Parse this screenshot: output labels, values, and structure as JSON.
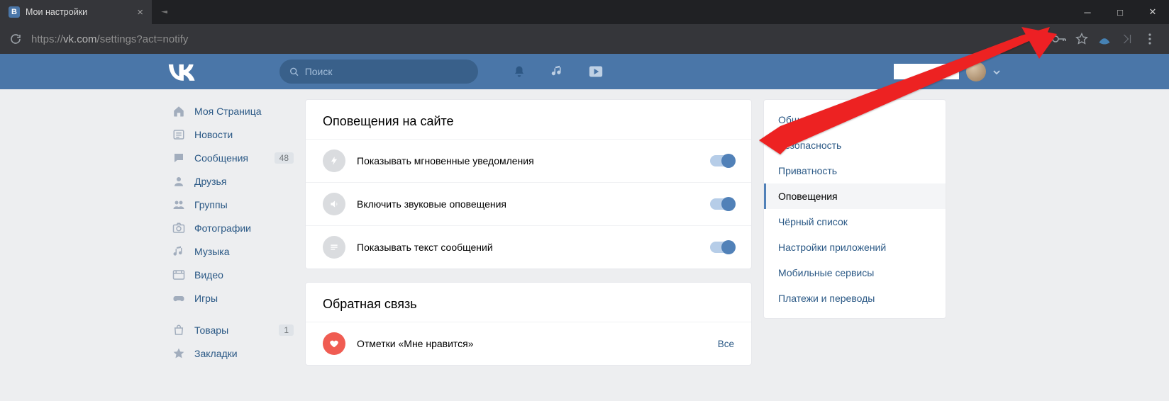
{
  "browser": {
    "tab_title": "Мои настройки",
    "url_proto": "https://",
    "url_host": "vk.com",
    "url_path": "/settings?act=notify"
  },
  "header": {
    "search_placeholder": "Поиск"
  },
  "leftnav": {
    "items": [
      {
        "label": "Моя Страница",
        "icon": "home"
      },
      {
        "label": "Новости",
        "icon": "news"
      },
      {
        "label": "Сообщения",
        "icon": "msg",
        "badge": "48"
      },
      {
        "label": "Друзья",
        "icon": "friends"
      },
      {
        "label": "Группы",
        "icon": "groups"
      },
      {
        "label": "Фотографии",
        "icon": "photo"
      },
      {
        "label": "Музыка",
        "icon": "music"
      },
      {
        "label": "Видео",
        "icon": "video"
      },
      {
        "label": "Игры",
        "icon": "games"
      }
    ],
    "items2": [
      {
        "label": "Товары",
        "icon": "market",
        "badge": "1"
      },
      {
        "label": "Закладки",
        "icon": "bookmark"
      }
    ]
  },
  "main": {
    "section1_title": "Оповещения на сайте",
    "section1_rows": [
      {
        "label": "Показывать мгновенные уведомления"
      },
      {
        "label": "Включить звуковые оповещения"
      },
      {
        "label": "Показывать текст сообщений"
      }
    ],
    "section2_title": "Обратная связь",
    "section2_rows": [
      {
        "label": "Отметки «Мне нравится»",
        "link": "Все"
      }
    ]
  },
  "tabs": {
    "items": [
      "Общее",
      "Безопасность",
      "Приватность",
      "Оповещения",
      "Чёрный список",
      "Настройки приложений",
      "Мобильные сервисы",
      "Платежи и переводы"
    ],
    "active_index": 3
  }
}
